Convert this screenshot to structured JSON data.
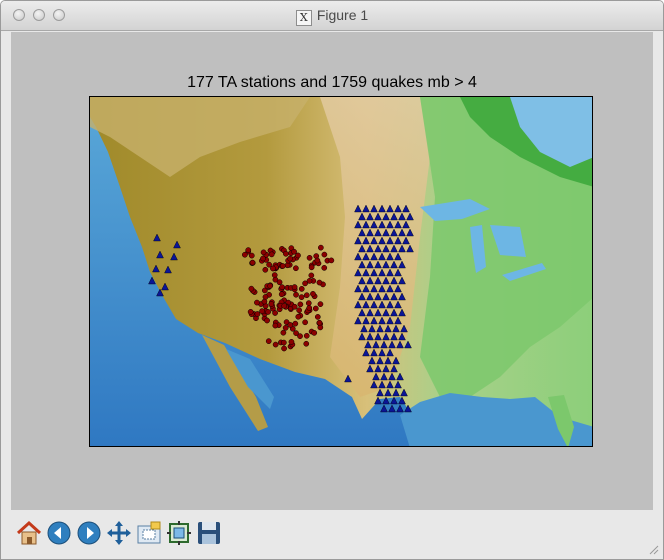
{
  "window": {
    "title": "Figure 1",
    "title_icon": "x11-icon"
  },
  "figure": {
    "title": "177 TA stations and 1759 quakes mb > 4"
  },
  "map": {
    "layers": [
      "shaded-relief-terrain",
      "ocean",
      "great-lakes",
      "gulf-of-mexico"
    ],
    "station_marker": {
      "shape": "triangle",
      "color": "#0b1596"
    },
    "quake_marker": {
      "shape": "star",
      "color": "#8b0000"
    }
  },
  "toolbar": {
    "buttons": [
      {
        "name": "home",
        "icon": "home-icon"
      },
      {
        "name": "back",
        "icon": "back-arrow-icon"
      },
      {
        "name": "forward",
        "icon": "forward-arrow-icon"
      },
      {
        "name": "pan",
        "icon": "pan-cross-icon"
      },
      {
        "name": "zoom",
        "icon": "zoom-rect-icon"
      },
      {
        "name": "subplots",
        "icon": "subplots-config-icon"
      },
      {
        "name": "save",
        "icon": "floppy-disk-icon"
      }
    ]
  }
}
